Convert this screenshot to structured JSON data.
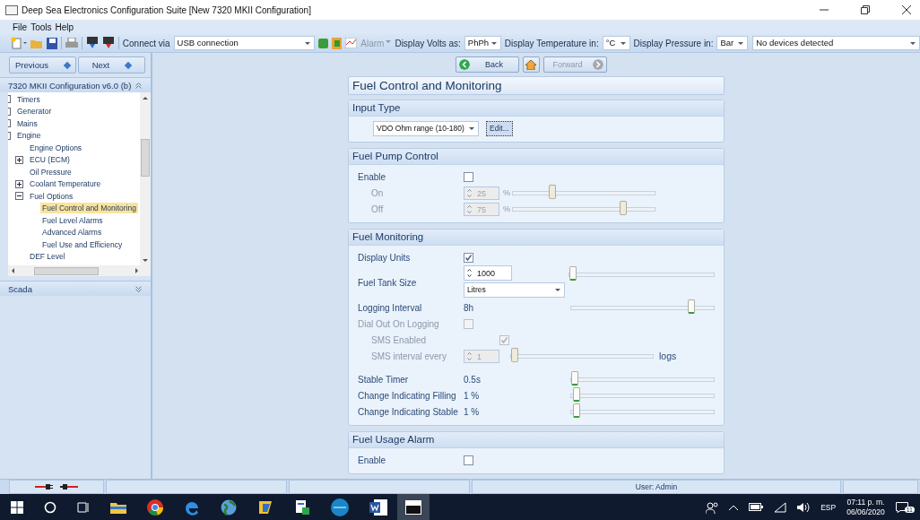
{
  "window": {
    "title": "Deep Sea Electronics Configuration Suite [New 7320 MKII Configuration]"
  },
  "menu": [
    {
      "label": "File"
    },
    {
      "label": "Tools"
    },
    {
      "label": "Help"
    }
  ],
  "toolbar": {
    "connect_label": "Connect via",
    "connect_value": "USB connection",
    "alarm": {
      "label": "Alarm",
      "disabled": true
    },
    "volts_label": "Display Volts as:",
    "volts_value": "PhPh",
    "temp_label": "Display Temperature in:",
    "temp_value": "°C",
    "pressure_label": "Display Pressure in:",
    "pressure_value": "Bar",
    "device_value": "No devices detected"
  },
  "nav": {
    "previous": "Previous",
    "next": "Next",
    "back": {
      "label": "Back",
      "disabled": false
    },
    "forward": {
      "label": "Forward",
      "disabled": true
    }
  },
  "tree": {
    "title": "7320 MKII Configuration v6.0 (b)",
    "items": [
      {
        "label": "Timers",
        "selected": false
      },
      {
        "label": "Generator",
        "selected": false
      },
      {
        "label": "Mains",
        "selected": false
      },
      {
        "label": "Engine",
        "selected": false,
        "children": [
          {
            "label": "Engine Options",
            "selected": false
          },
          {
            "label": "ECU (ECM)",
            "expanded": false,
            "selected": false
          },
          {
            "label": "Oil Pressure",
            "selected": false
          },
          {
            "label": "Coolant Temperature",
            "expanded": false,
            "selected": false
          },
          {
            "label": "Fuel Options",
            "expanded": true,
            "selected": false,
            "children": [
              {
                "label": "Fuel Control and Monitoring",
                "selected": true
              },
              {
                "label": "Fuel Level Alarms",
                "selected": false
              },
              {
                "label": "Advanced Alarms",
                "selected": false
              },
              {
                "label": "Fuel Use and Efficiency",
                "selected": false
              }
            ]
          },
          {
            "label": "DEF Level",
            "selected": false
          }
        ]
      }
    ]
  },
  "scada": {
    "title": "Scada"
  },
  "page_title": "Fuel Control and Monitoring",
  "sections": [
    {
      "title": "Input Type",
      "rows": [
        {
          "kind": "select-button",
          "value": "VDO Ohm range (10-180)",
          "button": "Edit..."
        }
      ]
    },
    {
      "title": "Fuel Pump Control",
      "rows": [
        {
          "kind": "check",
          "label": "Enable",
          "checked": false,
          "disabled": false,
          "children": [
            {
              "kind": "spin-slider",
              "label": "On",
              "value": "25",
              "unit": "%",
              "level": 0.25,
              "disabled": true
            },
            {
              "kind": "spin-slider",
              "label": "Off",
              "value": "75",
              "unit": "%",
              "level": 0.75,
              "disabled": true
            }
          ]
        }
      ]
    },
    {
      "title": "Fuel Monitoring",
      "rows": [
        {
          "kind": "check",
          "label": "Display Units",
          "checked": true,
          "disabled": false
        },
        {
          "kind": "spin-select-slider",
          "label": "Fuel Tank Size",
          "value": "1000",
          "select": "Litres",
          "level": 0,
          "disabled": false
        },
        {
          "kind": "value-slider",
          "label": "Logging Interval",
          "value": "8h",
          "level": 0.82,
          "disabled": false
        },
        {
          "kind": "check",
          "label": "Dial Out On Logging",
          "checked": false,
          "disabled": true,
          "children": [
            {
              "kind": "check",
              "label": "SMS Enabled",
              "checked": true,
              "disabled": true
            },
            {
              "kind": "spin-slider",
              "label": "SMS interval every",
              "value": "1",
              "trailing": "logs",
              "level": 0,
              "disabled": true
            }
          ]
        },
        {
          "kind": "value-slider",
          "label": "Stable Timer",
          "value": "0.5s",
          "level": 0,
          "disabled": false
        },
        {
          "kind": "value-slider",
          "label": "Change Indicating Filling",
          "value": "1 %",
          "level": 0.01,
          "disabled": false
        },
        {
          "kind": "value-slider",
          "label": "Change Indicating Stable",
          "value": "1 %",
          "level": 0.01,
          "disabled": false
        }
      ]
    },
    {
      "title": "Fuel Usage Alarm",
      "rows": [
        {
          "kind": "check",
          "label": "Enable",
          "checked": false,
          "disabled": false
        }
      ]
    }
  ],
  "status_bar": {
    "user": "User: Admin"
  },
  "taskbar": {
    "language": "ESP",
    "time": "07:11 p. m.",
    "date": "06/06/2020",
    "notifications": "11"
  }
}
